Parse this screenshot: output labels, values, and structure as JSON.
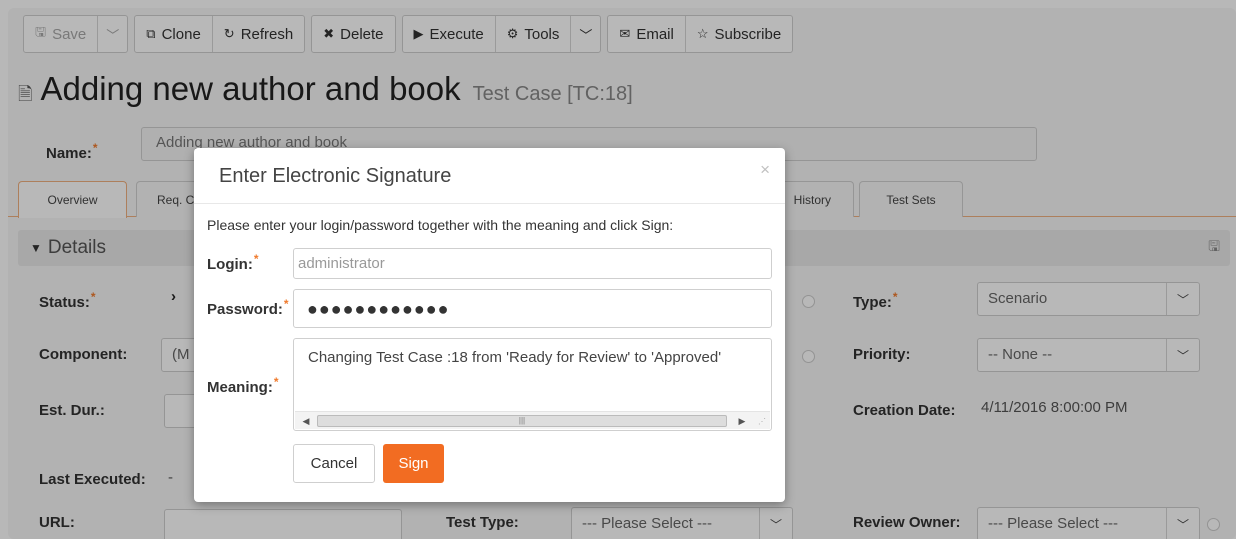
{
  "toolbar": {
    "save": "Save",
    "clone": "Clone",
    "refresh": "Refresh",
    "delete": "Delete",
    "execute": "Execute",
    "tools": "Tools",
    "email": "Email",
    "subscribe": "Subscribe"
  },
  "header": {
    "title": "Adding new author and book",
    "type_label": "Test Case [TC:18]"
  },
  "name_field": {
    "label": "Name:",
    "value": "Adding new author and book"
  },
  "tabs": [
    {
      "label": "Overview"
    },
    {
      "label": "Req. C"
    },
    {
      "label": "History"
    },
    {
      "label": "Test Sets"
    }
  ],
  "details": {
    "title": "Details",
    "status_label": "Status:",
    "component_label": "Component:",
    "component_value": "(M",
    "est_dur_label": "Est. Dur.:",
    "last_executed_label": "Last Executed:",
    "last_executed_value": "-",
    "url_label": "URL:",
    "test_type_label": "Test Type:",
    "test_type_value": "--- Please Select ---",
    "type_label": "Type:",
    "type_value": "Scenario",
    "priority_label": "Priority:",
    "priority_value": "-- None --",
    "creation_date_label": "Creation Date:",
    "creation_date_value": "4/11/2016 8:00:00 PM",
    "review_owner_label": "Review Owner:",
    "review_owner_value": "--- Please Select ---"
  },
  "modal": {
    "title": "Enter Electronic Signature",
    "close": "×",
    "instructions": "Please enter your login/password together with the meaning and click Sign:",
    "login_label": "Login:",
    "login_value": "administrator",
    "password_label": "Password:",
    "password_value": "●●●●●●●●●●●●",
    "meaning_label": "Meaning:",
    "meaning_value": "Changing Test Case :18 from 'Ready for Review' to 'Approved'",
    "cancel": "Cancel",
    "sign": "Sign"
  },
  "colors": {
    "accent": "#f26c22",
    "required": "#f07a2c"
  }
}
